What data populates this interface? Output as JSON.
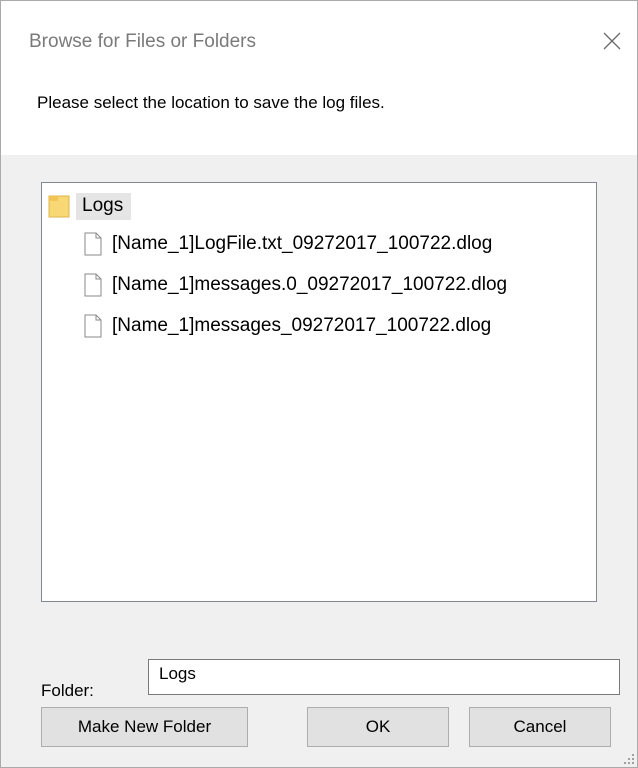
{
  "window": {
    "title": "Browse for Files or Folders",
    "close_icon": "close-icon"
  },
  "prompt": "Please select the location to save the log files.",
  "tree": {
    "root": {
      "label": "Logs",
      "icon": "folder-icon",
      "selected": true
    },
    "children": [
      {
        "label": "[Name_1]LogFile.txt_09272017_100722.dlog",
        "icon": "file-icon"
      },
      {
        "label": "[Name_1]messages.0_09272017_100722.dlog",
        "icon": "file-icon"
      },
      {
        "label": "[Name_1]messages_09272017_100722.dlog",
        "icon": "file-icon"
      }
    ]
  },
  "folder_field": {
    "label": "Folder:",
    "value": "Logs"
  },
  "buttons": {
    "make_new_folder": "Make New Folder",
    "ok": "OK",
    "cancel": "Cancel"
  },
  "colors": {
    "dialog_bg": "#f0f0f0",
    "folder_yellow": "#f8d775",
    "selection_bg": "#e5e5e5",
    "button_bg": "#e1e1e1"
  }
}
